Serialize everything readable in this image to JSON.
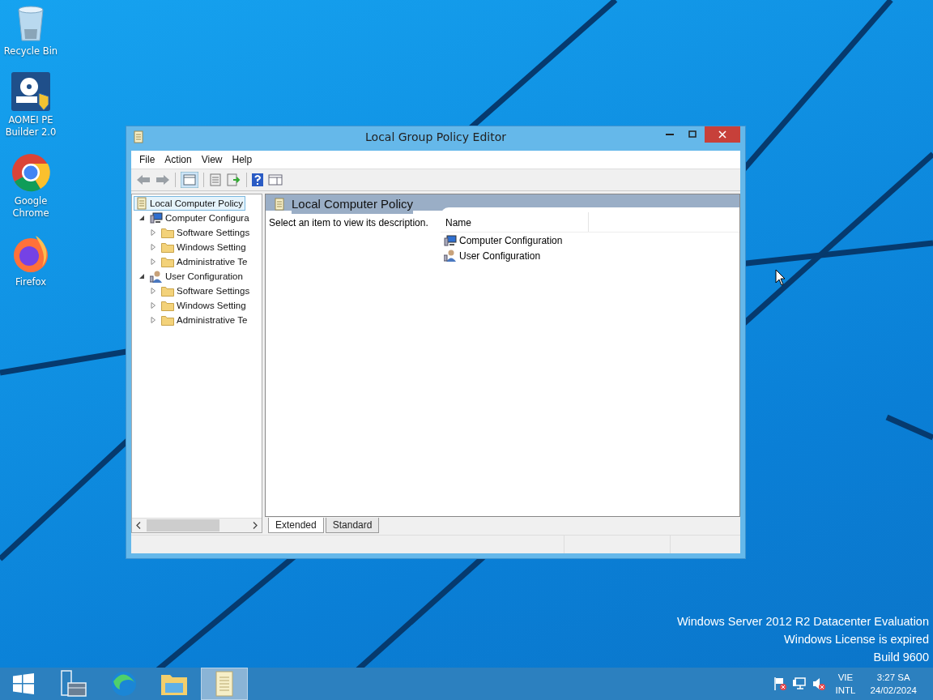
{
  "desktop_icons": [
    {
      "kind": "recycle-bin",
      "label": "Recycle Bin"
    },
    {
      "kind": "disk-tool",
      "label": "AOMEI PE Builder 2.0"
    },
    {
      "kind": "chrome",
      "label": "Google Chrome"
    },
    {
      "kind": "firefox",
      "label": "Firefox"
    }
  ],
  "window": {
    "title": "Local Group Policy Editor",
    "menu": [
      "File",
      "Action",
      "View",
      "Help"
    ],
    "tree": [
      {
        "label": "Local Computer Policy",
        "selected": true,
        "children": [
          {
            "label": "Computer Configura",
            "kind": "computer",
            "selected": false,
            "expanded": true,
            "children": [
              {
                "label": "Software Settings",
                "selected": false,
                "expanded": false
              },
              {
                "label": "Windows Setting",
                "selected": false,
                "expanded": false
              },
              {
                "label": "Administrative Te",
                "selected": false,
                "expanded": false
              }
            ]
          },
          {
            "label": "User Configuration",
            "kind": "user",
            "selected": false,
            "expanded": true,
            "children": [
              {
                "label": "Software Settings",
                "selected": false,
                "expanded": false
              },
              {
                "label": "Windows Setting",
                "selected": false,
                "expanded": false
              },
              {
                "label": "Administrative Te",
                "selected": false,
                "expanded": false
              }
            ]
          }
        ]
      }
    ],
    "details_title": "Local Computer Policy",
    "description": "Select an item to view its description.",
    "list": {
      "columns": [
        "Name"
      ],
      "items": [
        {
          "label": "Computer Configuration",
          "kind": "computer"
        },
        {
          "label": "User Configuration",
          "kind": "user"
        }
      ]
    },
    "tabs": [
      {
        "label": "Extended",
        "selected": true
      },
      {
        "label": "Standard",
        "selected": false
      }
    ]
  },
  "system_notice": [
    "Windows Server 2012 R2 Datacenter Evaluation",
    "Windows License is expired",
    "Build 9600"
  ],
  "taskbar": {
    "apps": [
      {
        "kind": "server-manager",
        "active": false
      },
      {
        "kind": "edge",
        "active": false
      },
      {
        "kind": "explorer",
        "active": false
      },
      {
        "kind": "gpedit",
        "active": true
      }
    ],
    "language": "VIE",
    "layout": "INTL",
    "time": "3:27 SA",
    "date": "24/02/2024"
  }
}
